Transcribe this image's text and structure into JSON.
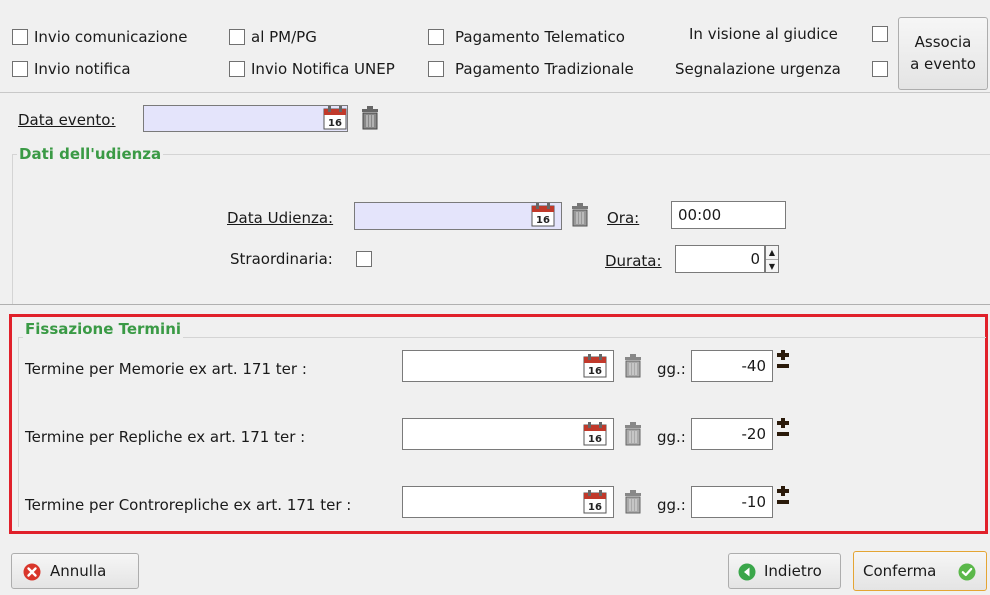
{
  "top_options": {
    "invio_comunicazione": "Invio comunicazione",
    "invio_notifica": "Invio notifica",
    "al_pm_pg": "al PM/PG",
    "invio_notifica_unep": "Invio Notifica UNEP",
    "pagamento_telematico": "Pagamento Telematico",
    "pagamento_tradizionale": "Pagamento Tradizionale",
    "in_visione_giudice": "In visione al giudice",
    "segnalazione_urgenza": "Segnalazione urgenza",
    "associa_line1": "Associa",
    "associa_line2": "a evento"
  },
  "evento": {
    "data_evento_label": "Data evento:",
    "data_evento_value": ""
  },
  "udienza": {
    "group_title": "Dati dell'udienza",
    "data_udienza_label": "Data Udienza:",
    "data_udienza_value": "",
    "ora_label": "Ora:",
    "ora_value": "00:00",
    "straordinaria_label": "Straordinaria:",
    "durata_label": "Durata:",
    "durata_value": "0"
  },
  "termini": {
    "group_title": "Fissazione Termini",
    "rows": [
      {
        "label": "Termine per Memorie ex art. 171 ter :",
        "value": "",
        "gg_label": "gg.:",
        "gg_value": "-40"
      },
      {
        "label": "Termine per Repliche ex art. 171 ter :",
        "value": "",
        "gg_label": "gg.:",
        "gg_value": "-20"
      },
      {
        "label": "Termine per Controrepliche ex art. 171 ter :",
        "value": "",
        "gg_label": "gg.:",
        "gg_value": "-10"
      }
    ]
  },
  "calendar_day": "16",
  "footer": {
    "annulla": "Annulla",
    "indietro": "Indietro",
    "conferma": "Conferma"
  },
  "colors": {
    "highlight_border": "#e0202a",
    "group_title": "#3a9a45",
    "date_field_bg": "#e4e4fb"
  }
}
